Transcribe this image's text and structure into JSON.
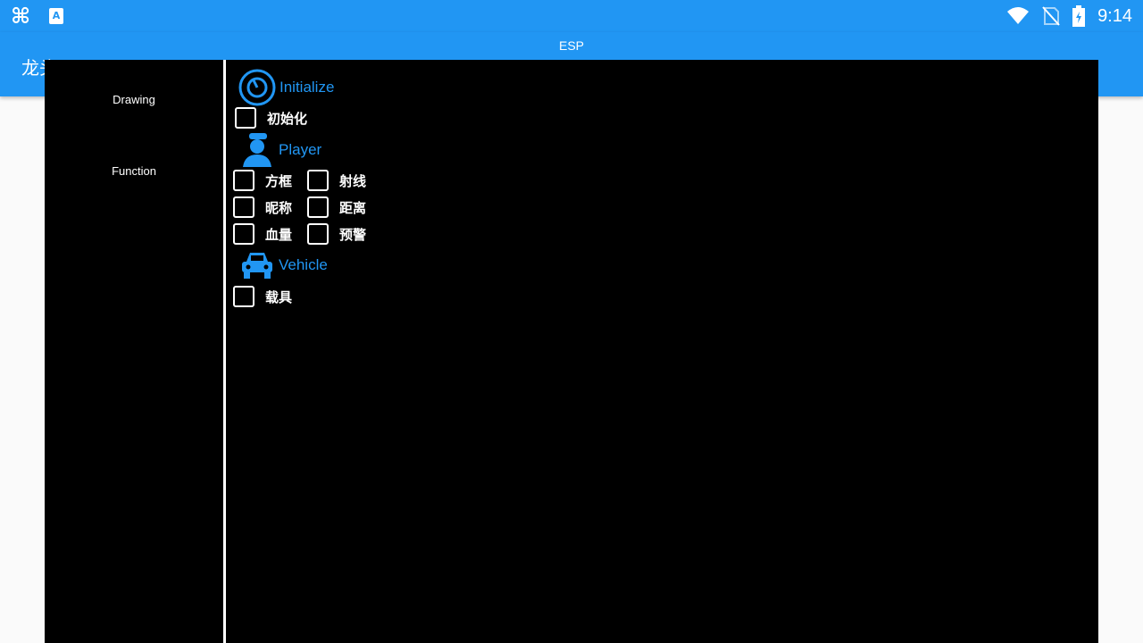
{
  "status_bar": {
    "time": "9:14",
    "left_icons": [
      "app-notification-icon",
      "text-app-icon"
    ],
    "right_icons": [
      "wifi-icon",
      "no-sim-icon",
      "battery-icon"
    ]
  },
  "app_bar": {
    "title": "龙头",
    "color": "#2196f3"
  },
  "window": {
    "title": "ESP"
  },
  "sidebar": {
    "items": [
      {
        "label": "Drawing"
      },
      {
        "label": "Function"
      }
    ]
  },
  "sections": {
    "initialize": {
      "title": "Initialize",
      "icon": "power-timer-icon",
      "options": [
        {
          "label": "初始化",
          "checked": false
        }
      ]
    },
    "player": {
      "title": "Player",
      "icon": "person-icon",
      "options": [
        {
          "label": "方框",
          "checked": false
        },
        {
          "label": "射线",
          "checked": false
        },
        {
          "label": "昵称",
          "checked": false
        },
        {
          "label": "距离",
          "checked": false
        },
        {
          "label": "血量",
          "checked": false
        },
        {
          "label": "预警",
          "checked": false
        }
      ]
    },
    "vehicle": {
      "title": "Vehicle",
      "icon": "car-icon",
      "options": [
        {
          "label": "载具",
          "checked": false
        }
      ]
    }
  },
  "colors": {
    "accent": "#2196f3",
    "panel_bg": "#000000",
    "text": "#ffffff"
  }
}
